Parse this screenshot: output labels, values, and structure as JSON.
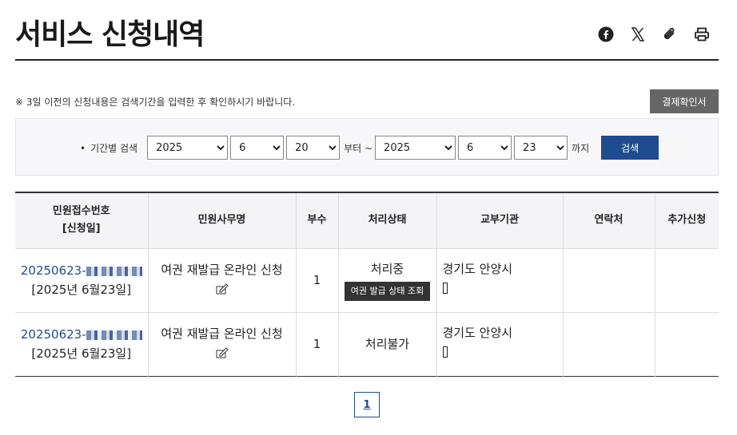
{
  "page": {
    "title": "서비스 신청내역",
    "share_icons": [
      "facebook-icon",
      "x-icon",
      "paperclip-icon",
      "print-icon"
    ]
  },
  "notice": "※ 3일 이전의 신청내용은 검색기간을 입력한 후 확인하시기 바랍니다.",
  "receipt_button": "결제확인서",
  "search": {
    "label": "기간별 검색",
    "from": {
      "year": "2025",
      "month": "6",
      "day": "20"
    },
    "from_suffix": "부터 ~",
    "to": {
      "year": "2025",
      "month": "6",
      "day": "23"
    },
    "to_suffix": "까지",
    "button": "검색"
  },
  "table": {
    "headers": {
      "receipt_no": "민원접수번호",
      "apply_date": "[신청일]",
      "service_name": "민원사무명",
      "copies": "부수",
      "status": "처리상태",
      "agency": "교부기관",
      "contact": "연락처",
      "extra": "추가신청"
    },
    "rows": [
      {
        "receipt_prefix": "20250623-",
        "date": "[2025년 6월23일]",
        "service": "여권 재발급 온라인 신청",
        "copies": "1",
        "status": "처리중",
        "status_button": "여권 발급 상태 조회",
        "agency": "경기도 안양시",
        "agency_glyph": "",
        "contact": "",
        "extra": ""
      },
      {
        "receipt_prefix": "20250623-",
        "date": "[2025년 6월23일]",
        "service": "여권 재발급 온라인 신청",
        "copies": "1",
        "status": "처리불가",
        "agency": "경기도 안양시",
        "agency_glyph": "",
        "contact": "",
        "extra": ""
      }
    ]
  },
  "pagination": {
    "current": "1"
  },
  "colors": {
    "accent": "#1f4c8f",
    "gray_button": "#666666",
    "dark_button": "#333333"
  }
}
